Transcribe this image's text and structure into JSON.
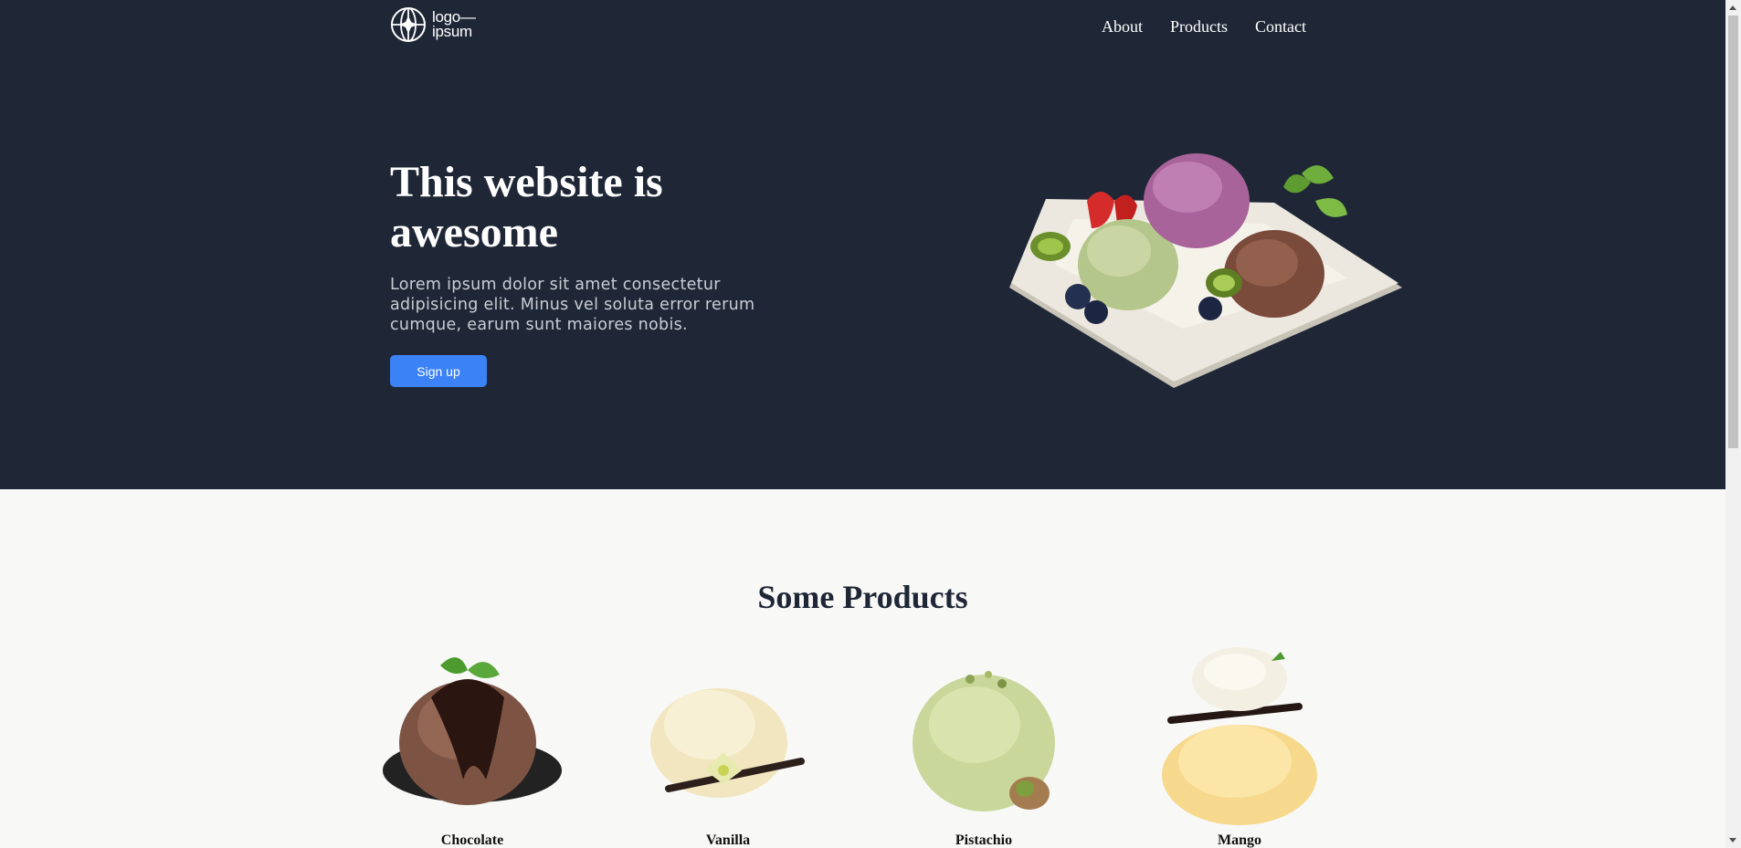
{
  "header": {
    "logo": {
      "line1": "logo—",
      "line2": "ipsum"
    },
    "nav": [
      "About",
      "Products",
      "Contact"
    ]
  },
  "hero": {
    "title": "This website is awesome",
    "description": "Lorem ipsum dolor sit amet consectetur adipisicing elit. Minus vel soluta error rerum cumque, earum sunt maiores nobis.",
    "cta_label": "Sign up",
    "background_color": "#1f2736",
    "accent_color": "#3b82f6"
  },
  "products": {
    "title": "Some Products",
    "items": [
      {
        "name": "Chocolate"
      },
      {
        "name": "Vanilla"
      },
      {
        "name": "Pistachio"
      },
      {
        "name": "Mango"
      }
    ]
  }
}
